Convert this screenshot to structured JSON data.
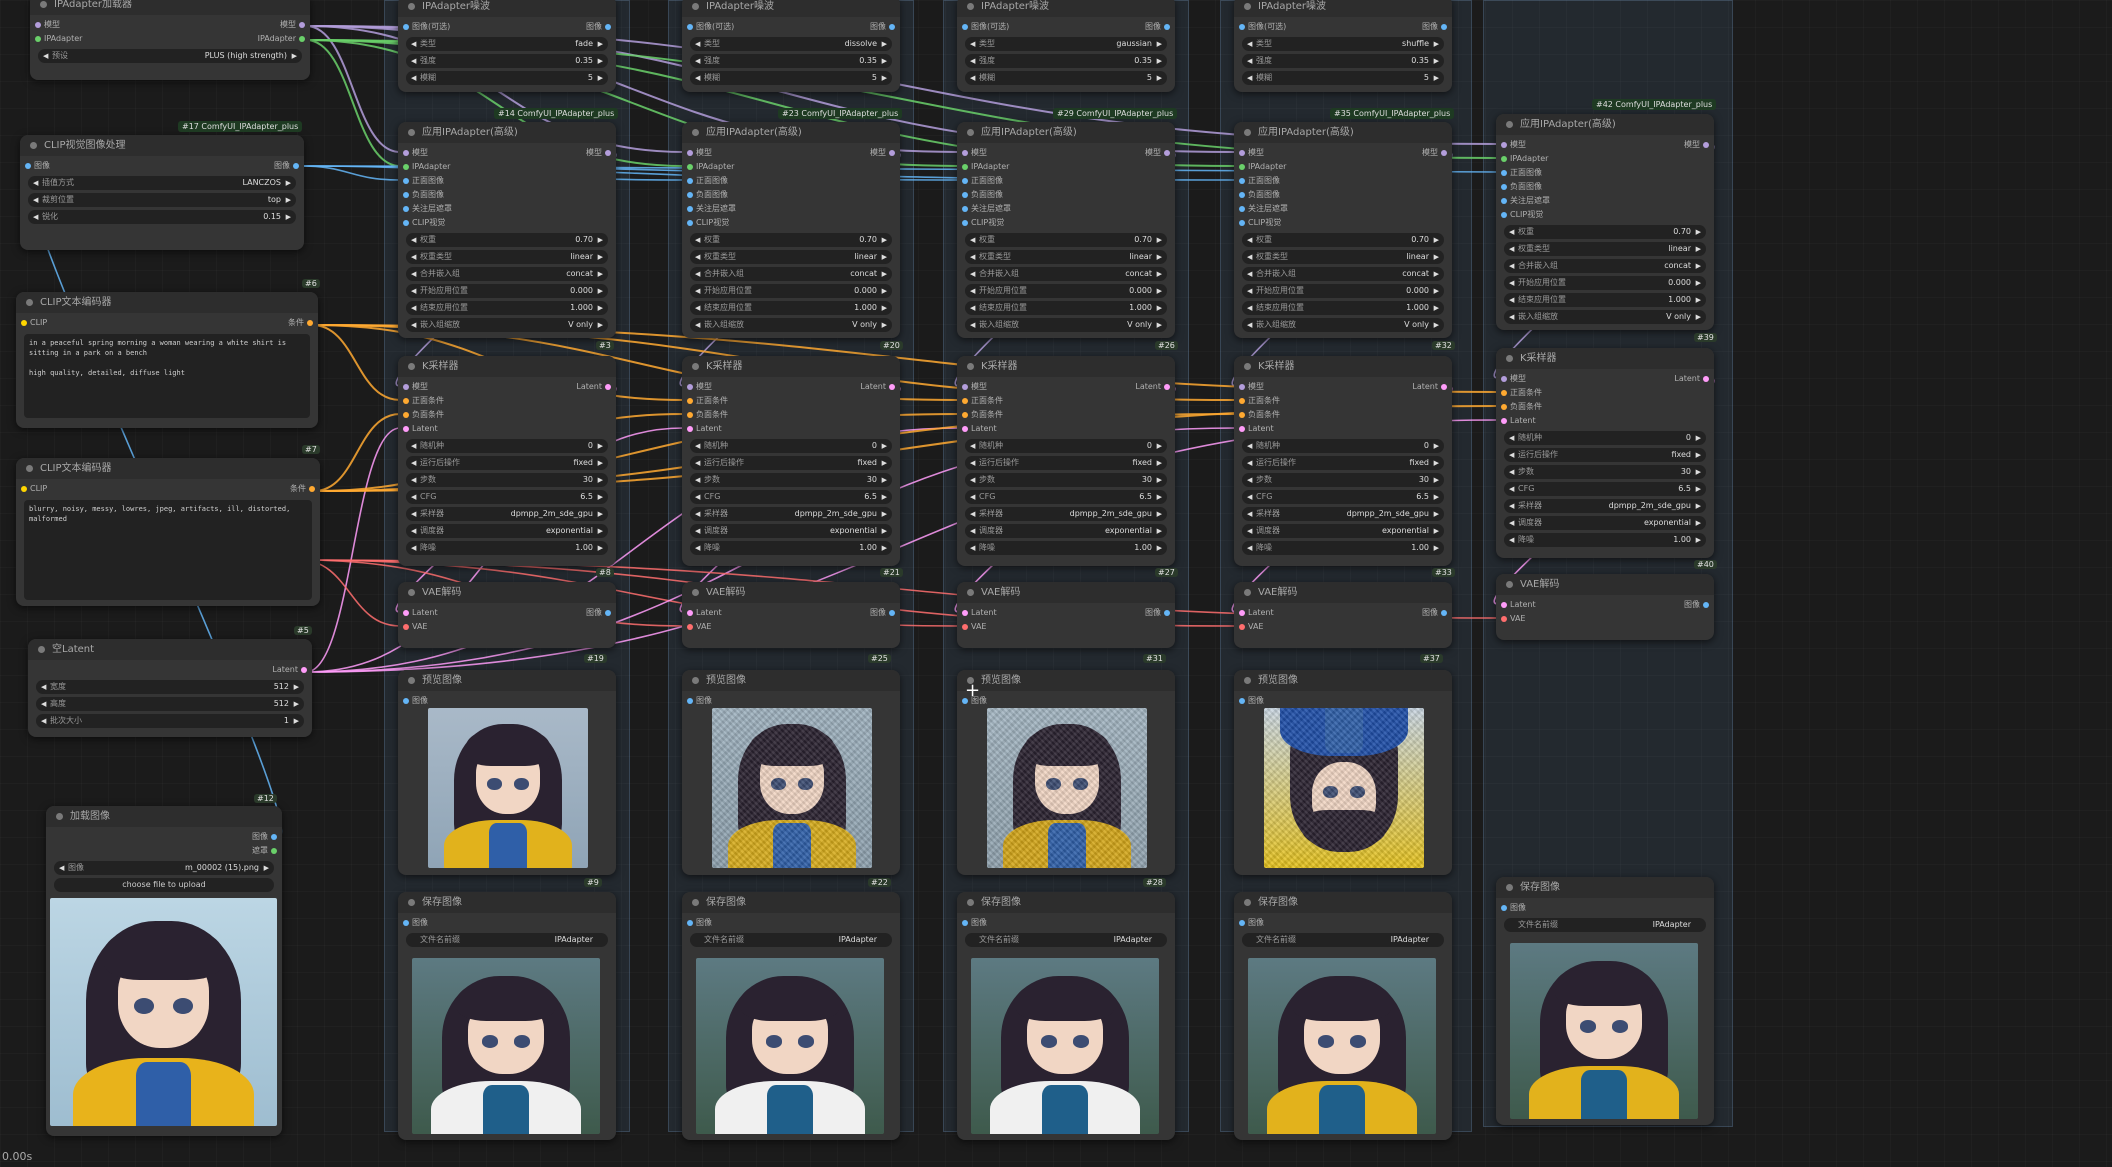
{
  "status_time": "0.00s",
  "colors": {
    "model": "#b39ddb",
    "clip": "#ffd600",
    "ipadapter": "#6ad06a",
    "image": "#64b5f6",
    "latent": "#ff9cf9",
    "vae": "#ff6e6e",
    "conditioning": "#ffa931"
  },
  "ipadapter_loader": {
    "title": "IPAdapter加载器",
    "inputs": [
      "模型",
      "IPAdapter"
    ],
    "outputs": [
      "模型",
      "IPAdapter"
    ],
    "preset_label": "预设",
    "preset_value": "PLUS (high strength)"
  },
  "clip_vision": {
    "title": "CLIP视觉图像处理",
    "input": "图像",
    "output": "图像",
    "widgets": [
      {
        "label": "插值方式",
        "value": "LANCZOS"
      },
      {
        "label": "裁剪位置",
        "value": "top"
      },
      {
        "label": "锐化",
        "value": "0.15"
      }
    ],
    "badge": "#17 ComfyUI_IPAdapter_plus",
    "id": "#6"
  },
  "clip_pos": {
    "title": "CLIP文本编码器",
    "input": "CLIP",
    "output": "条件",
    "text": "in a peaceful spring morning a woman wearing a white shirt is sitting in a park on a bench\n\nhigh quality, detailed, diffuse light",
    "id": "#7"
  },
  "clip_neg": {
    "title": "CLIP文本编码器",
    "input": "CLIP",
    "output": "条件",
    "text": "blurry, noisy, messy, lowres, jpeg, artifacts, ill, distorted, malformed",
    "id": "#5"
  },
  "empty_latent": {
    "title": "空Latent",
    "output": "Latent",
    "widgets": [
      {
        "label": "宽度",
        "value": "512"
      },
      {
        "label": "高度",
        "value": "512"
      },
      {
        "label": "批次大小",
        "value": "1"
      }
    ],
    "id": "#12"
  },
  "load_image": {
    "title": "加载图像",
    "outputs": [
      "图像",
      "遮罩"
    ],
    "file_label": "图像",
    "file_value": "m_00002 (15).png",
    "upload_label": "choose file to upload"
  },
  "columns": [
    {
      "noise_title": "IPAdapter噪波",
      "noise_input": "图像(可选)",
      "noise_output": "图像",
      "noise_type": "fade",
      "noise_strength": "0.35",
      "noise_blur": "5",
      "apply_badge": "#14 ComfyUI_IPAdapter_plus",
      "apply_id": "#3",
      "ks_id": "#8",
      "vae_id": "#19",
      "preview_id": "#9"
    },
    {
      "noise_title": "IPAdapter噪波",
      "noise_input": "图像(可选)",
      "noise_output": "图像",
      "noise_type": "dissolve",
      "noise_strength": "0.35",
      "noise_blur": "5",
      "apply_badge": "#23 ComfyUI_IPAdapter_plus",
      "apply_id": "#20",
      "ks_id": "#21",
      "vae_id": "#25",
      "preview_id": "#22"
    },
    {
      "noise_title": "IPAdapter噪波",
      "noise_input": "图像(可选)",
      "noise_output": "图像",
      "noise_type": "gaussian",
      "noise_strength": "0.35",
      "noise_blur": "5",
      "apply_badge": "#29 ComfyUI_IPAdapter_plus",
      "apply_id": "#26",
      "ks_id": "#27",
      "vae_id": "#31",
      "preview_id": "#28"
    },
    {
      "noise_title": "IPAdapter噪波",
      "noise_input": "图像(可选)",
      "noise_output": "图像",
      "noise_type": "shuffle",
      "noise_strength": "0.35",
      "noise_blur": "5",
      "apply_badge": "#35 ComfyUI_IPAdapter_plus",
      "apply_id": "#32",
      "ks_id": "#33",
      "vae_id": "#37",
      "preview_id": ""
    },
    {
      "noise_title": "",
      "noise_input": "",
      "noise_output": "",
      "noise_type": "",
      "noise_strength": "",
      "noise_blur": "",
      "apply_badge": "#42 ComfyUI_IPAdapter_plus",
      "apply_id": "#39",
      "ks_id": "#40",
      "vae_id": "",
      "preview_id": "#41"
    }
  ],
  "noise_labels": {
    "type": "类型",
    "strength": "强度",
    "blur": "模糊"
  },
  "apply": {
    "title": "应用IPAdapter(高级)",
    "inputs": [
      "模型",
      "IPAdapter",
      "正面图像",
      "负面图像",
      "关注层遮罩",
      "CLIP视觉"
    ],
    "output": "模型",
    "widgets": [
      {
        "label": "权重",
        "value": "0.70"
      },
      {
        "label": "权重类型",
        "value": "linear"
      },
      {
        "label": "合并嵌入组",
        "value": "concat"
      },
      {
        "label": "开始应用位置",
        "value": "0.000"
      },
      {
        "label": "结束应用位置",
        "value": "1.000"
      },
      {
        "label": "嵌入组缩放",
        "value": "V only"
      }
    ]
  },
  "ksampler": {
    "title": "K采样器",
    "inputs": [
      "模型",
      "正面条件",
      "负面条件",
      "Latent"
    ],
    "output": "Latent",
    "widgets": [
      {
        "label": "随机种",
        "value": "0"
      },
      {
        "label": "运行后操作",
        "value": "fixed"
      },
      {
        "label": "步数",
        "value": "30"
      },
      {
        "label": "CFG",
        "value": "6.5"
      },
      {
        "label": "采样器",
        "value": "dpmpp_2m_sde_gpu"
      },
      {
        "label": "调度器",
        "value": "exponential"
      },
      {
        "label": "降噪",
        "value": "1.00"
      }
    ]
  },
  "vae_decode": {
    "title": "VAE解码",
    "inputs": [
      "Latent",
      "VAE"
    ],
    "output": "图像"
  },
  "preview": {
    "title": "预览图像",
    "input": "图像"
  },
  "save": {
    "title": "保存图像",
    "input": "图像",
    "prefix_label": "文件名前缀",
    "prefix_value": "IPAdapter"
  }
}
